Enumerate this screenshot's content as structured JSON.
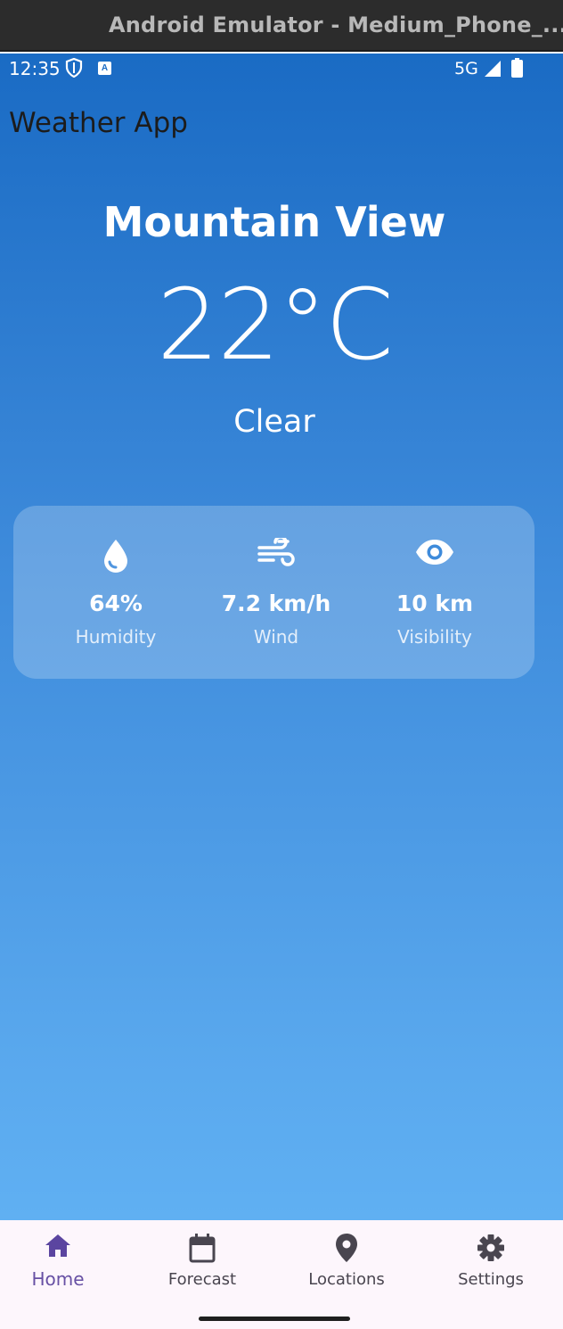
{
  "window": {
    "title": "Android Emulator - Medium_Phone_..."
  },
  "status_bar": {
    "time": "12:35",
    "network": "5G"
  },
  "app_bar": {
    "title": "Weather App"
  },
  "weather": {
    "city": "Mountain View",
    "temperature": "22°C",
    "condition": "Clear"
  },
  "stats": [
    {
      "icon": "water-drop-icon",
      "value": "64%",
      "label": "Humidity"
    },
    {
      "icon": "wind-icon",
      "value": "7.2 km/h",
      "label": "Wind"
    },
    {
      "icon": "eye-icon",
      "value": "10 km",
      "label": "Visibility"
    }
  ],
  "bottom_nav": {
    "active": "Home",
    "items": [
      {
        "icon": "home-icon",
        "label": "Home"
      },
      {
        "icon": "calendar-icon",
        "label": "Forecast"
      },
      {
        "icon": "location-pin-icon",
        "label": "Locations"
      },
      {
        "icon": "gear-icon",
        "label": "Settings"
      }
    ]
  },
  "colors": {
    "gradient_top": "#1a6bc4",
    "gradient_bottom": "#64b5f6",
    "nav_active": "#6750a4",
    "nav_inactive": "#49454f"
  }
}
